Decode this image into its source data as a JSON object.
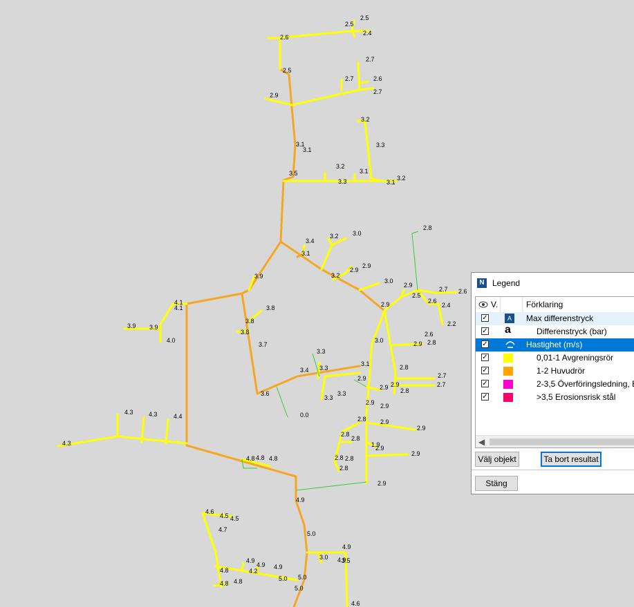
{
  "map": {
    "labels": [
      [
        "2.5",
        521,
        29
      ],
      [
        "2.5",
        499,
        38
      ],
      [
        "2.4",
        525,
        51
      ],
      [
        "2.6",
        405,
        57
      ],
      [
        "2.5",
        409,
        105
      ],
      [
        "2.9",
        390,
        141
      ],
      [
        "2.7",
        529,
        89
      ],
      [
        "2.7",
        499,
        117
      ],
      [
        "2.6",
        540,
        117
      ],
      [
        "2.7",
        540,
        136
      ],
      [
        "3.2",
        522,
        176
      ],
      [
        "3.3",
        544,
        213
      ],
      [
        "3.1",
        428,
        212
      ],
      [
        "3.1",
        438,
        220
      ],
      [
        "3.5",
        418,
        254
      ],
      [
        "3.2",
        486,
        244
      ],
      [
        "3.1",
        520,
        251
      ],
      [
        "3.3",
        489,
        266
      ],
      [
        "3.1",
        559,
        267
      ],
      [
        "3.2",
        574,
        261
      ],
      [
        "2.8",
        612,
        333
      ],
      [
        "3.4",
        442,
        352
      ],
      [
        "3.2",
        477,
        345
      ],
      [
        "3.0",
        510,
        341
      ],
      [
        "3.1",
        436,
        370
      ],
      [
        "2.9",
        524,
        388
      ],
      [
        "2.9",
        506,
        394
      ],
      [
        "3.2",
        479,
        402
      ],
      [
        "3.9",
        368,
        403
      ],
      [
        "3.0",
        556,
        410
      ],
      [
        "2.9",
        584,
        416
      ],
      [
        "2.7",
        635,
        422
      ],
      [
        "2.6",
        663,
        425
      ],
      [
        "2.5",
        596,
        431
      ],
      [
        "2.6",
        619,
        439
      ],
      [
        "2.4",
        639,
        445
      ],
      [
        "2.2",
        647,
        472
      ],
      [
        "2.9",
        551,
        444
      ],
      [
        "4.1",
        252,
        441
      ],
      [
        "4.1",
        252,
        449
      ],
      [
        "3.8",
        385,
        449
      ],
      [
        "3.9",
        184,
        475
      ],
      [
        "3.9",
        216,
        477
      ],
      [
        "3.8",
        355,
        468
      ],
      [
        "3.8",
        348,
        484
      ],
      [
        "3.7",
        374,
        502
      ],
      [
        "4.0",
        241,
        496
      ],
      [
        "2.6",
        614,
        487
      ],
      [
        "2.8",
        618,
        499
      ],
      [
        "3.0",
        542,
        496
      ],
      [
        "2.9",
        598,
        501
      ],
      [
        "3.3",
        458,
        512
      ],
      [
        "3.1",
        522,
        530
      ],
      [
        "3.4",
        434,
        539
      ],
      [
        "3.3",
        462,
        536
      ],
      [
        "2.8",
        578,
        535
      ],
      [
        "2.9",
        517,
        551
      ],
      [
        "2.9",
        565,
        560
      ],
      [
        "2.7",
        633,
        547
      ],
      [
        "2.7",
        632,
        560
      ],
      [
        "2.8",
        579,
        569
      ],
      [
        "2.9",
        549,
        564
      ],
      [
        "3.6",
        377,
        573
      ],
      [
        "3.3",
        469,
        579
      ],
      [
        "3.3",
        488,
        573
      ],
      [
        "2.9",
        529,
        586
      ],
      [
        "2.9",
        550,
        591
      ],
      [
        "0.0",
        434,
        604
      ],
      [
        "4.3",
        180,
        600
      ],
      [
        "4.3",
        215,
        603
      ],
      [
        "4.4",
        251,
        606
      ],
      [
        "2.8",
        517,
        610
      ],
      [
        "2.9",
        550,
        614
      ],
      [
        "2.9",
        603,
        623
      ],
      [
        "2.8",
        493,
        632
      ],
      [
        "2.8",
        508,
        638
      ],
      [
        "1.9",
        537,
        647
      ],
      [
        "2.9",
        543,
        652
      ],
      [
        "4.3",
        90,
        645
      ],
      [
        "2.9",
        595,
        660
      ],
      [
        "2.8",
        484,
        666
      ],
      [
        "2.8",
        499,
        667
      ],
      [
        "2.8",
        491,
        681
      ],
      [
        "4.8",
        356,
        667
      ],
      [
        "4.8",
        370,
        666
      ],
      [
        "4.8",
        389,
        667
      ],
      [
        "2.9",
        546,
        703
      ],
      [
        "4.9",
        428,
        727
      ],
      [
        "4.6",
        297,
        744
      ],
      [
        "4.5",
        318,
        750
      ],
      [
        "4.5",
        333,
        754
      ],
      [
        "4.7",
        316,
        770
      ],
      [
        "5.0",
        444,
        776
      ],
      [
        "4.9",
        495,
        795
      ],
      [
        "3.0",
        462,
        810
      ],
      [
        "4.9",
        488,
        814
      ],
      [
        "3.5",
        494,
        815
      ],
      [
        "4.9",
        356,
        815
      ],
      [
        "4.9",
        371,
        821
      ],
      [
        "4.9",
        396,
        824
      ],
      [
        "4.2",
        360,
        830
      ],
      [
        "4.8",
        318,
        829
      ],
      [
        "5.0",
        403,
        841
      ],
      [
        "5.0",
        431,
        839
      ],
      [
        "4.8",
        318,
        848
      ],
      [
        "4.8",
        338,
        845
      ],
      [
        "5.0",
        426,
        855
      ],
      [
        "4.6",
        508,
        877
      ]
    ]
  },
  "legend": {
    "title": "Legend",
    "header_v": "V.",
    "header_text": "Förklaring",
    "rows": [
      {
        "label": "Max differenstryck",
        "checked": "✓",
        "icon": "box-icon",
        "state": "hover"
      },
      {
        "label": "Differenstryck (bar)",
        "checked": "✓",
        "icon": "a-text-icon",
        "state": "normal"
      },
      {
        "label": "Hastighet (m/s)",
        "checked": "✓",
        "icon": "flow-icon",
        "state": "selected"
      },
      {
        "label": "0,01-1   Avgreningsrör",
        "checked": "✓",
        "color": "#ffff00"
      },
      {
        "label": "1-2     Huvudrör",
        "checked": "✓",
        "color": "#ffa500"
      },
      {
        "label": "2-3,5  Överföringsledning, Bl",
        "checked": "✓",
        "color": "#ff00cc"
      },
      {
        "label": ">3,5     Erosionsrisk stål",
        "checked": "✓",
        "color": "#ff0066"
      }
    ],
    "buttons": {
      "select": "Välj objekt",
      "remove": "Ta bort resultat",
      "close": "Stäng"
    }
  },
  "colors": {
    "yellow": "#ffff00",
    "orange": "#f5a623",
    "green": "#33cc33",
    "selection": "#0078d7"
  }
}
